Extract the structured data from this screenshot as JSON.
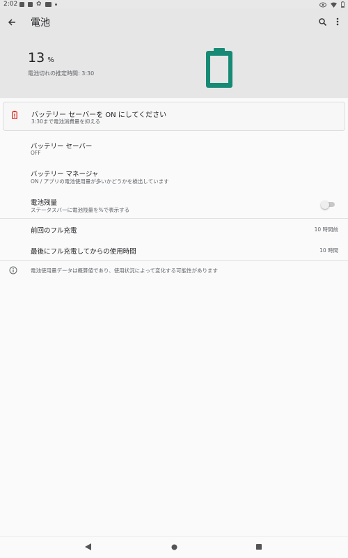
{
  "status_bar": {
    "time": "2:02",
    "left_icons": [
      "sim-icon",
      "image-icon",
      "settings-icon",
      "gallery-icon",
      "dot-icon"
    ],
    "right_icons": [
      "eye-icon",
      "wifi-icon",
      "battery-icon"
    ]
  },
  "header": {
    "title": "電池",
    "battery_percent": "13",
    "percent_unit": "%",
    "estimate": "電池切れの推定時間: 3:30",
    "accent_color": "#178a76"
  },
  "banner": {
    "title": "バッテリー セーバーを ON にしてください",
    "subtitle": "3:30まで電池消費量を抑える",
    "icon_color": "#d93025"
  },
  "settings": {
    "battery_saver": {
      "title": "バッテリー セーバー",
      "subtitle": "OFF"
    },
    "battery_manager": {
      "title": "バッテリー マネージャ",
      "subtitle": "ON / アプリの電池使用量が多いかどうかを検出しています"
    },
    "battery_percentage": {
      "title": "電池残量",
      "subtitle": "ステータスバーに電池残量を%で表示する",
      "enabled": false
    },
    "last_full_charge": {
      "title": "前回のフル充電",
      "value": "10 時間前"
    },
    "usage_since_full": {
      "title": "最後にフル充電してからの使用時間",
      "value": "10 時間"
    }
  },
  "footer_note": "電池使用量データは概算値であり、使用状況によって変化する可能性があります",
  "navbar": {
    "buttons": [
      "back-triangle-icon",
      "home-circle-icon",
      "recents-square-icon"
    ]
  }
}
